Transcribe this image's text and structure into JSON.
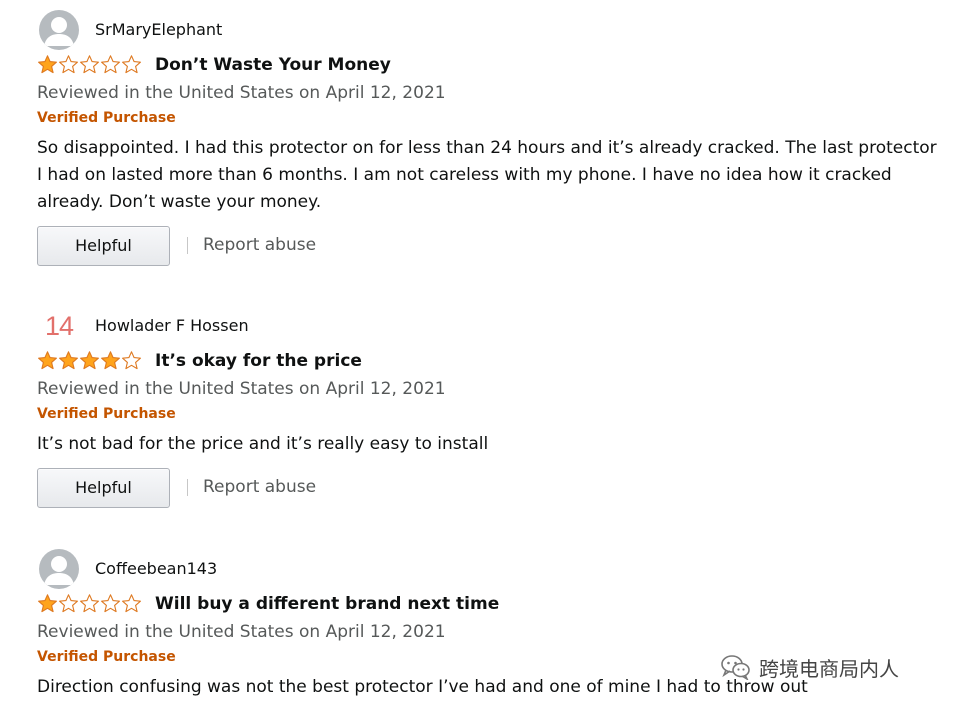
{
  "colors": {
    "star_filled": "#ffa41c",
    "star_outline": "#de7921",
    "verified": "#c45500",
    "meta_text": "#565959",
    "body_text": "#0f1111",
    "avatar_bg": "#b6bbbf"
  },
  "reviews": [
    {
      "profile_name": "SrMaryElephant",
      "avatar": "default-person-icon",
      "rating": 1,
      "rating_max": 5,
      "title": "Don’t Waste Your Money",
      "date_line": "Reviewed in the United States on April 12, 2021",
      "verified": "Verified Purchase",
      "body": "So disappointed. I had this protector on for less than 24 hours and it’s already cracked. The last protector I had on lasted more than 6 months. I am not careless with my phone. I have no idea how it cracked already. Don’t waste your money.",
      "helpful_label": "Helpful",
      "report_label": "Report abuse"
    },
    {
      "profile_name": "Howlader F Hossen",
      "avatar": "14",
      "rating": 4,
      "rating_max": 5,
      "title": "It’s okay for the price",
      "date_line": "Reviewed in the United States on April 12, 2021",
      "verified": "Verified Purchase",
      "body": "It’s not bad for the price and it’s really easy to install",
      "helpful_label": "Helpful",
      "report_label": "Report abuse"
    },
    {
      "profile_name": "Coffeebean143",
      "avatar": "default-person-icon",
      "rating": 1,
      "rating_max": 5,
      "title": "Will buy a different brand next time",
      "date_line": "Reviewed in the United States on April 12, 2021",
      "verified": "Verified Purchase",
      "body": "Direction confusing was not the best protector I’ve had and one of mine I had to throw out"
    }
  ],
  "watermark": {
    "icon": "wechat-icon",
    "text": "跨境电商局内人"
  }
}
